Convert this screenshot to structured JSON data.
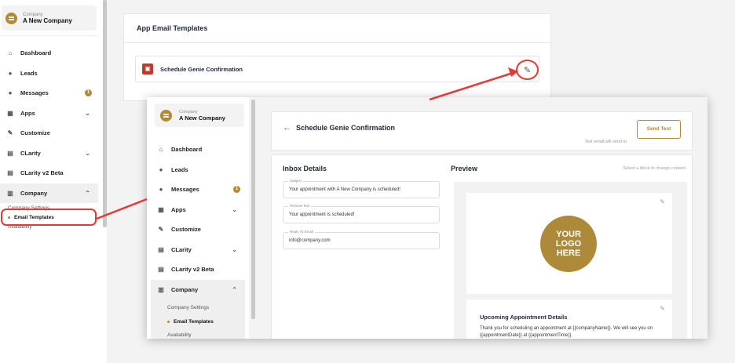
{
  "colors": {
    "accent": "#b28a33",
    "highlight": "#e53935",
    "template_icon": "#c0392b"
  },
  "company": {
    "label": "Company",
    "name": "A New Company"
  },
  "nav": {
    "items": [
      {
        "label": "Dashboard",
        "icon": "home-icon"
      },
      {
        "label": "Leads",
        "icon": "person-icon"
      },
      {
        "label": "Messages",
        "icon": "chat-bubble-icon",
        "badge": "1"
      },
      {
        "label": "Apps",
        "icon": "grid-icon"
      },
      {
        "label": "Customize",
        "icon": "wand-icon"
      },
      {
        "label": "CLarity",
        "icon": "bar-chart-icon"
      },
      {
        "label": "CLarity v2 Beta",
        "icon": "bar-chart-icon"
      },
      {
        "label": "Company",
        "icon": "building-icon"
      }
    ],
    "sub_items": [
      {
        "label": "Company Settings"
      },
      {
        "label": "Email Templates"
      },
      {
        "label": "Availability"
      }
    ]
  },
  "back_page": {
    "panel_title": "App Email Templates",
    "template_name": "Schedule Genie Confirmation"
  },
  "front_page": {
    "title": "Schedule Genie Confirmation",
    "send_test_label": "Send Test",
    "test_note": "Test email will send to",
    "inbox_details_title": "Inbox Details",
    "fields": [
      {
        "label": "Subject",
        "value": "Your appointment with A New Company is scheduled!"
      },
      {
        "label": "Preview Text",
        "value": "Your appointment is scheduled!"
      },
      {
        "label": "Reply To Email",
        "value": "info@company.com"
      }
    ],
    "preview_title": "Preview",
    "preview_hint": "Select a block to change content",
    "logo_text": "YOUR LOGO HERE",
    "appointment_title": "Upcoming Appointment Details",
    "appointment_body": "Thank you for scheduling an appointment at {{companyName}}. We will see you on {{appointmentDate}} at {{appointmentTime}}."
  }
}
